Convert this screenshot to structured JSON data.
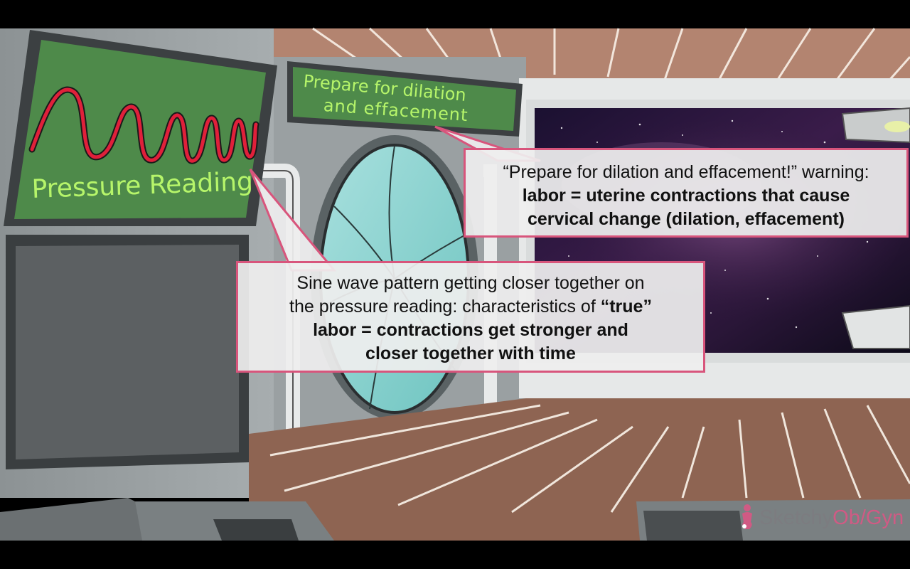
{
  "scene": {
    "pressure_sign_label": "Pressure Reading",
    "prepare_sign_line1": "Prepare for dilation",
    "prepare_sign_line2": "and effacement",
    "colors": {
      "callout_border": "#d8557c",
      "sign_text": "#b6f56a",
      "sign_wave": "#e0203a",
      "sign_screen": "#4e8a4a"
    }
  },
  "callouts": {
    "top": {
      "line1": "“Prepare for dilation and effacement!” warning:",
      "line2": "labor = uterine contractions that cause",
      "line3": "cervical change (dilation, effacement)"
    },
    "mid": {
      "line1": "Sine wave pattern getting closer together on",
      "line2_normal": "the pressure reading: characteristics of ",
      "line2_bold": "“true”",
      "line3": "labor = contractions get stronger and",
      "line4": "closer together with time"
    }
  },
  "logo": {
    "text_part1": "Sketchy",
    "text_part2": "Ob/Gyn",
    "icon": "figure-icon"
  }
}
